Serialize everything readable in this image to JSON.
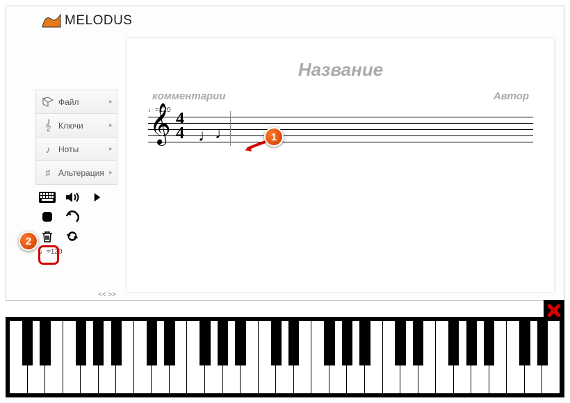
{
  "app": {
    "name": "MELODUS"
  },
  "sidebar": {
    "items": [
      {
        "label": "Файл"
      },
      {
        "label": "Ключи"
      },
      {
        "label": "Ноты"
      },
      {
        "label": "Альтерация"
      }
    ]
  },
  "toolbar": {
    "tempo_display": "♩=120",
    "tempo_small": "♩=120",
    "nav": "<< >>"
  },
  "score": {
    "title": "Название",
    "comments": "комментарии",
    "author": "Автор",
    "tempo": "♩=120",
    "timesig_top": "4",
    "timesig_bottom": "4"
  },
  "callouts": {
    "c1": "1",
    "c2": "2"
  },
  "piano": {
    "white_keys": 31
  }
}
